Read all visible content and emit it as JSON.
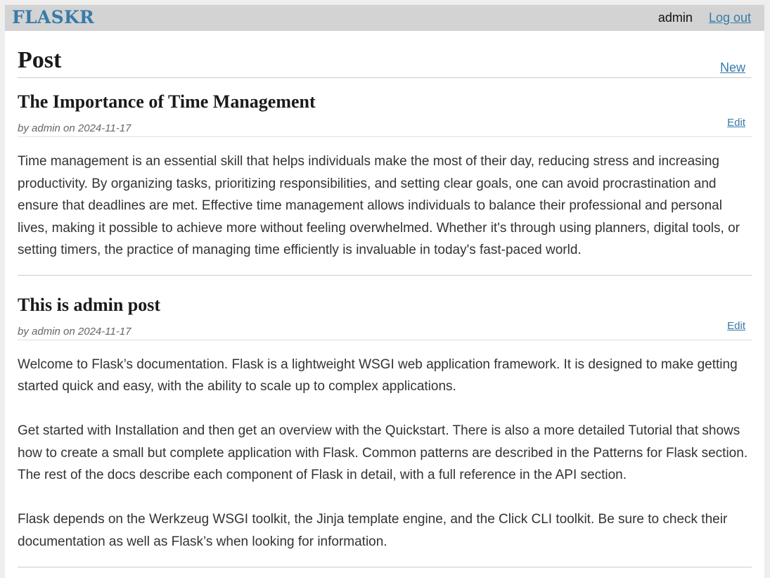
{
  "nav": {
    "title": "FLASKR",
    "user": "admin",
    "logout_label": "Log out"
  },
  "header": {
    "title": "Post",
    "new_label": "New"
  },
  "posts": [
    {
      "title": "The Importance of Time Management",
      "meta": "by admin on 2024-11-17",
      "edit_label": "Edit",
      "body": "Time management is an essential skill that helps individuals make the most of their day, reducing stress and increasing productivity. By organizing tasks, prioritizing responsibilities, and setting clear goals, one can avoid procrastination and ensure that deadlines are met. Effective time management allows individuals to balance their professional and personal lives, making it possible to achieve more without feeling overwhelmed. Whether it's through using planners, digital tools, or setting timers, the practice of managing time efficiently is invaluable in today's fast-paced world."
    },
    {
      "title": "This is admin post",
      "meta": "by admin on 2024-11-17",
      "edit_label": "Edit",
      "body": "Welcome to Flask’s documentation. Flask is a lightweight WSGI web application framework. It is designed to make getting started quick and easy, with the ability to scale up to complex applications.\n\nGet started with Installation and then get an overview with the Quickstart. There is also a more detailed Tutorial that shows how to create a small but complete application with Flask. Common patterns are described in the Patterns for Flask section. The rest of the docs describe each component of Flask in detail, with a full reference in the API section.\n\nFlask depends on the Werkzeug WSGI toolkit, the Jinja template engine, and the Click CLI toolkit. Be sure to check their documentation as well as Flask’s when looking for information."
    }
  ],
  "colors": {
    "link": "#377ba8",
    "nav_background": "#d3d3d3",
    "page_background": "#eeeeee"
  }
}
